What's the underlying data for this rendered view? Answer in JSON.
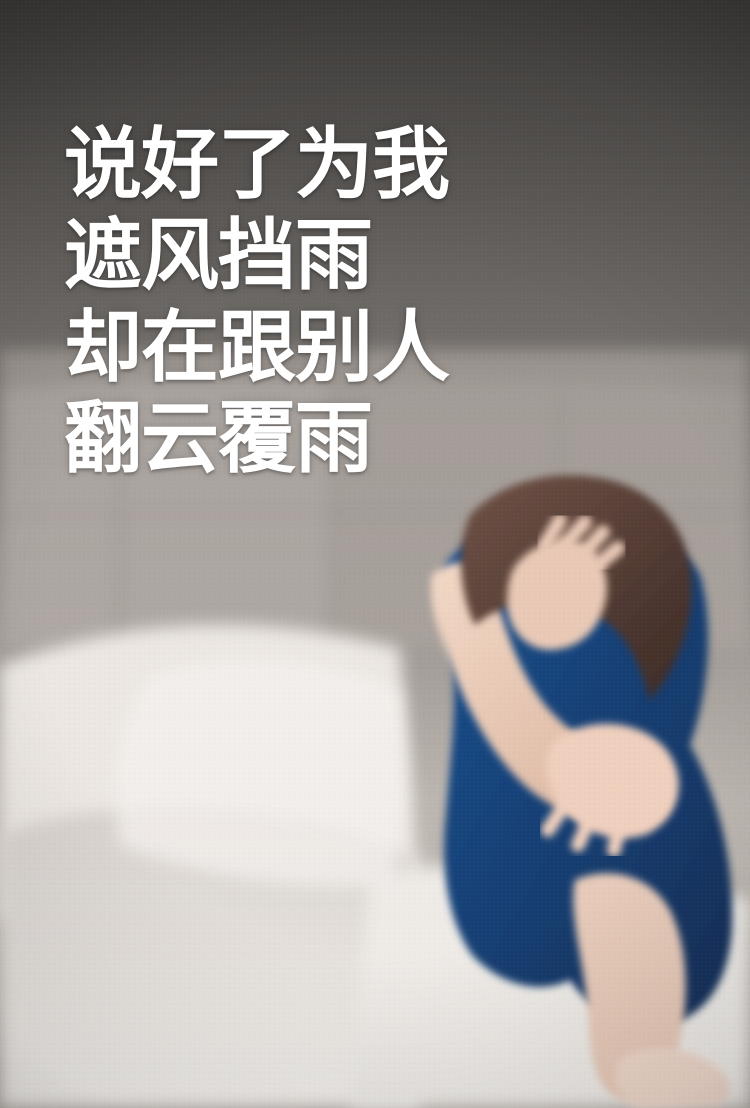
{
  "headline": {
    "lines": [
      "说好了为我",
      "遮风挡雨",
      "却在跟别人",
      "翻云覆雨"
    ]
  },
  "colors": {
    "text": "#ffffff",
    "dress": "#173f74",
    "bedding": "#ece8e3",
    "headboard": "#9e9792"
  }
}
